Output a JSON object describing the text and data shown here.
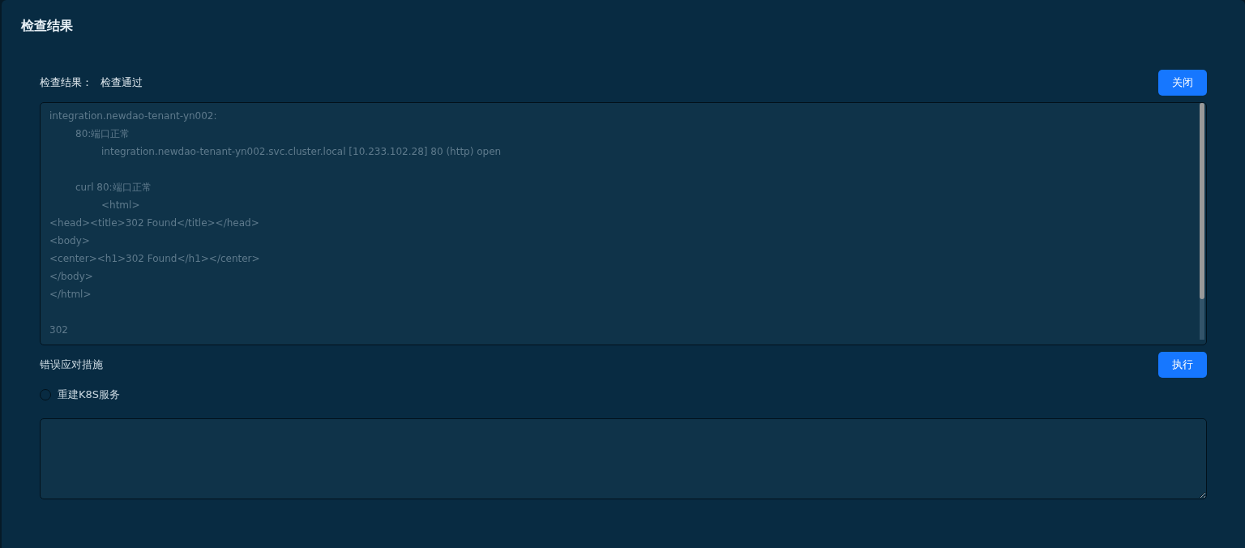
{
  "panel": {
    "title": "检查结果"
  },
  "result": {
    "label": "检查结果：",
    "value": "检查通过",
    "close_button": "关闭"
  },
  "log": {
    "text": "integration.newdao-tenant-yn002:\n\t80:端口正常\n\t\tintegration.newdao-tenant-yn002.svc.cluster.local [10.233.102.28] 80 (http) open\n\n\tcurl 80:端口正常\n\t\t<html>\n<head><title>302 Found</title></head>\n<body>\n<center><h1>302 Found</h1></center>\n</body>\n</html>\n\n302"
  },
  "remedy": {
    "label": "错误应对措施",
    "execute_button": "执行",
    "options": [
      {
        "label": "重建K8S服务",
        "selected": false
      }
    ]
  }
}
